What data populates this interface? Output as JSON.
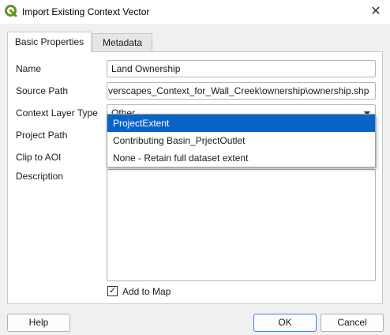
{
  "window": {
    "title": "Import Existing Context Vector"
  },
  "tabs": [
    {
      "label": "Basic Properties"
    },
    {
      "label": "Metadata"
    }
  ],
  "form": {
    "name_label": "Name",
    "name_value": "Land Ownership",
    "source_path_label": "Source Path",
    "source_path_value": "verscapes_Context_for_Wall_Creek\\ownership\\ownership.shp",
    "context_layer_type_label": "Context Layer Type",
    "context_layer_type_value": "Other",
    "project_path_label": "Project Path",
    "clip_to_aoi_label": "Clip to AOI",
    "description_label": "Description",
    "add_to_map_label": "Add to Map",
    "add_to_map_checked": true
  },
  "clip_dropdown": {
    "options": [
      "ProjectExtent",
      "Contributing Basin_PrjectOutlet",
      "None - Retain full dataset extent"
    ],
    "selected_index": 0
  },
  "buttons": {
    "help": "Help",
    "ok": "OK",
    "cancel": "Cancel"
  },
  "colors": {
    "selection": "#0a64c8",
    "default_button_border": "#3c82d7"
  }
}
